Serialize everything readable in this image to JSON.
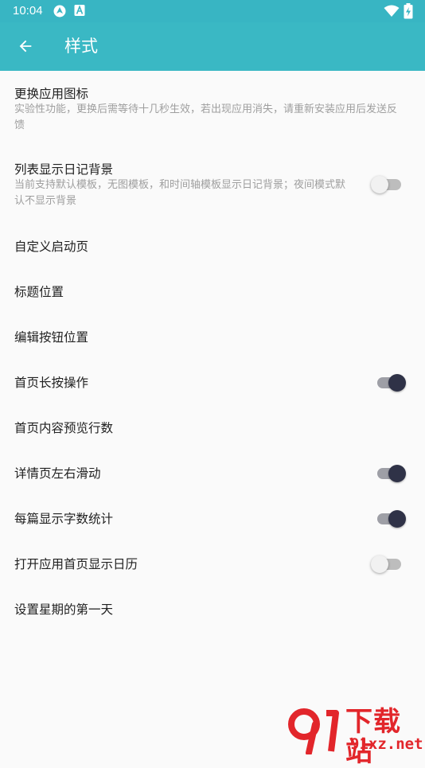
{
  "status_bar": {
    "time": "10:04",
    "icons": [
      "location-icon",
      "text-a-icon",
      "wifi-icon",
      "battery-charging-icon"
    ]
  },
  "toolbar": {
    "title": "样式",
    "back_icon": "arrow-left-icon",
    "background": "#3ab8c4"
  },
  "settings": {
    "change_icon": {
      "label": "更换应用图标",
      "summary_line1": "实验性功能，更换后需等待十几秒生效，若出现应用消失，请重新安装应用后发送反",
      "summary_line2": "馈"
    },
    "list_diary_bg": {
      "label": "列表显示日记背景",
      "summary_line1": "当前支持默认模板，无图模板，和时间轴模板显示日记背景；夜间模式默",
      "summary_line2": "认不显示背景",
      "checked": false
    },
    "custom_start_page": {
      "label": "自定义启动页"
    },
    "title_position": {
      "label": "标题位置"
    },
    "edit_button_position": {
      "label": "编辑按钮位置"
    },
    "home_long_press": {
      "label": "首页长按操作",
      "checked": true
    },
    "home_preview_lines": {
      "label": "首页内容预览行数"
    },
    "detail_swipe": {
      "label": "详情页左右滑动",
      "checked": true
    },
    "word_count": {
      "label": "每篇显示字数统计",
      "checked": true
    },
    "open_calendar": {
      "label": "打开应用首页显示日历",
      "checked": false
    },
    "first_weekday": {
      "label": "设置星期的第一天"
    }
  },
  "watermark": {
    "text_cn": "下载站",
    "text_en": "91xz.net",
    "color": "#e2262b"
  }
}
